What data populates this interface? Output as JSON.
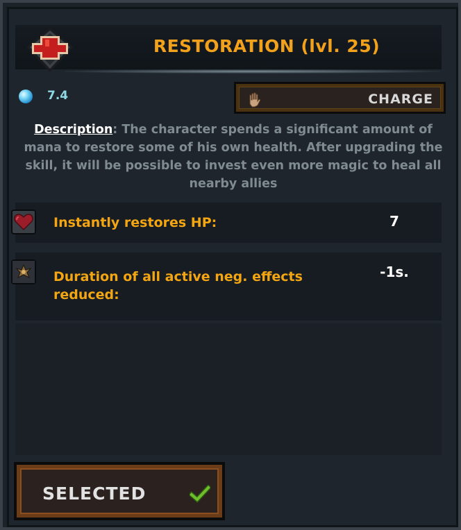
{
  "skill": {
    "title": "RESTORATION (lvl. 25)",
    "icon": "red-cross-icon",
    "mana_cost": "7.4",
    "mana_icon": "mana-orb-icon",
    "cast_type_label": "CHARGE",
    "cast_type_icon": "hand-icon"
  },
  "description": {
    "label": "Description",
    "separator": ":",
    "text": " The character spends a significant amount of mana to restore some of his own health. After upgrading the skill, it will be possible to invest even more magic to heal all nearby allies"
  },
  "stats": [
    {
      "label": "Instantly restores HP:",
      "value": "7",
      "icon": "heart-icon"
    },
    {
      "label": "Duration of all active neg. effects reduced:",
      "value": "-1s.",
      "icon": "curse-debuff-icon"
    }
  ],
  "footer": {
    "selected_label": "SELECTED",
    "selected_icon": "checkmark-icon"
  },
  "colors": {
    "title": "#f1a11b",
    "stat_label": "#f3a612",
    "mana_value": "#8fd8e6",
    "description_text": "#7f8a92",
    "panel_background": "#1e252c",
    "button_border": "#8a4f20",
    "checkmark": "#6fbf2a"
  }
}
